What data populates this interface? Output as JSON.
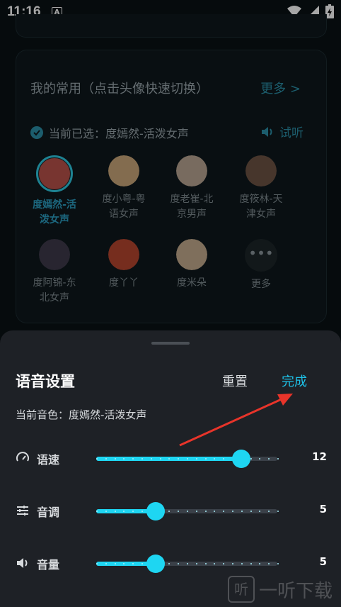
{
  "status_bar": {
    "time": "11:16",
    "notification": "A"
  },
  "favorites": {
    "title": "我的常用（点击头像快速切换）",
    "more": "更多 >",
    "selected_prefix": "当前已选：度嫣然-活泼女声",
    "listen": "试听",
    "voices": [
      {
        "name_line1": "度嫣然-活",
        "name_line2": "泼女声",
        "selected": true,
        "color": "#b9524a"
      },
      {
        "name_line1": "度小粤-粤",
        "name_line2": "语女声",
        "selected": false,
        "color": "#c9a77a"
      },
      {
        "name_line1": "度老崔-北",
        "name_line2": "京男声",
        "selected": false,
        "color": "#b8a592"
      },
      {
        "name_line1": "度筱林-天",
        "name_line2": "津女声",
        "selected": false,
        "color": "#6e5444"
      },
      {
        "name_line1": "度阿锦-东",
        "name_line2": "北女声",
        "selected": false,
        "color": "#3e3a4a"
      },
      {
        "name_line1": "度丫丫",
        "name_line2": "",
        "selected": false,
        "color": "#b5452f"
      },
      {
        "name_line1": "度米朵",
        "name_line2": "",
        "selected": false,
        "color": "#c4ab8e"
      },
      {
        "name_line1": "更多",
        "name_line2": "",
        "selected": false,
        "color": "#1c2529"
      }
    ]
  },
  "sheet": {
    "title": "语音设置",
    "reset": "重置",
    "done": "完成",
    "current_tone": "当前音色：度嫣然-活泼女声",
    "sliders": [
      {
        "label": "语速",
        "value": "12",
        "level": 0.8,
        "icon": "speedometer-icon"
      },
      {
        "label": "音调",
        "value": "5",
        "level": 0.33,
        "icon": "sliders-icon"
      },
      {
        "label": "音量",
        "value": "5",
        "level": 0.33,
        "icon": "speaker-icon"
      }
    ]
  },
  "watermark": {
    "mark": "听",
    "text": "一听下载"
  },
  "colors": {
    "accent": "#1ed6f2",
    "link": "#2b8fa8",
    "sheet_bg": "#1e2126",
    "page_bg": "#0a1114"
  }
}
